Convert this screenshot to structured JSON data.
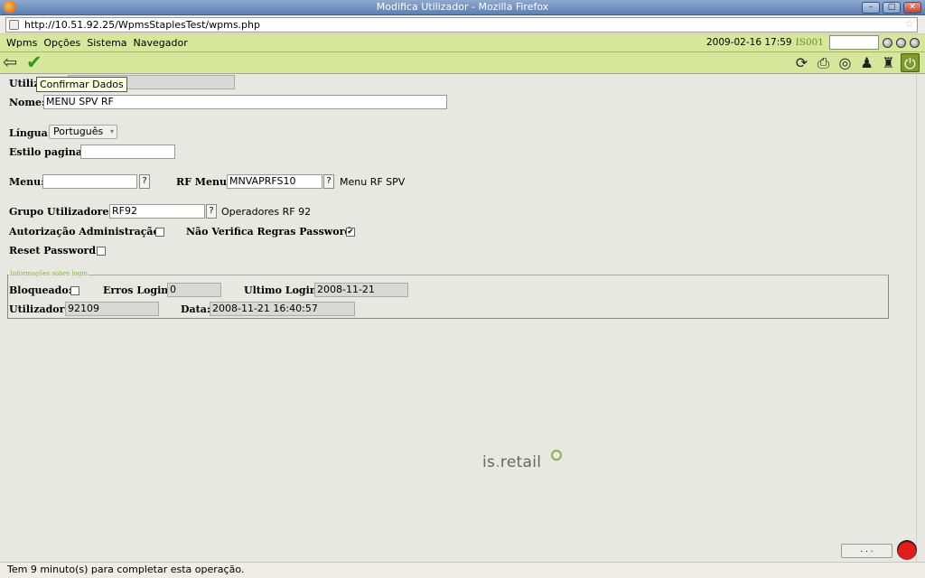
{
  "window": {
    "title": "Modifica Utilizador - Mozilla Firefox"
  },
  "browser": {
    "url": "http://10.51.92.25/WpmsStaplesTest/wpms.php"
  },
  "menubar": {
    "items": [
      "Wpms",
      "Opções",
      "Sistema",
      "Navegador"
    ],
    "datetime": "2009-02-16 17:59",
    "company": "IS001"
  },
  "toolbar": {
    "tooltip": "Confirmar Dados"
  },
  "form": {
    "utilizador_label": "Utiliz",
    "nome_label": "Nome:",
    "nome_value": "MENU SPV RF",
    "lingua_label": "Língua:",
    "lingua_value": "Português",
    "estilo_label": "Estilo pagina:",
    "menu_label": "Menu:",
    "rf_menu_label": "RF Menu:",
    "rf_menu_value": "MNVAPRFS10",
    "rf_menu_desc": "Menu RF SPV",
    "grupo_label": "Grupo Utilizadores:",
    "grupo_value": "RF92",
    "grupo_desc": "Operadores RF 92",
    "autorizacao_label": "Autorização Administração:",
    "nao_verifica_label": "Não Verifica Regras Password:",
    "reset_label": "Reset Password:",
    "help_label": "?"
  },
  "login_info": {
    "legend": "Informações sobre login",
    "bloqueado_label": "Bloqueado:",
    "erros_label": "Erros Login:",
    "erros_value": "0",
    "ultimo_label": "Ultimo Login:",
    "ultimo_value": "2008-11-21",
    "utilizador_label": "Utilizador:",
    "utilizador_value": "92109",
    "data_label": "Data:",
    "data_value": "2008-11-21  16:40:57"
  },
  "brand": {
    "prefix": "is",
    "dot": ".",
    "name": "retail"
  },
  "footer": {
    "button": ". . ."
  },
  "status": {
    "text": "Tem 9 minuto(s) para completar esta operação."
  },
  "colors": {
    "menubar_bg": "#d6e69b",
    "accent_green": "#8ab04a",
    "confirm_check": "#2f9a1c"
  }
}
